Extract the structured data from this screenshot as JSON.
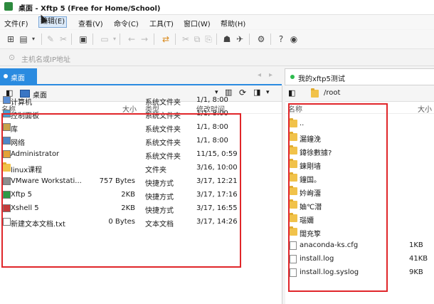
{
  "window": {
    "title": "桌面   - Xftp 5 (Free for Home/School)"
  },
  "menu": [
    {
      "label": "文件(F)"
    },
    {
      "label": "编辑(E)"
    },
    {
      "label": "查看(V)"
    },
    {
      "label": "命令(C)"
    },
    {
      "label": "工具(T)"
    },
    {
      "label": "窗口(W)"
    },
    {
      "label": "帮助(H)"
    }
  ],
  "address": {
    "placeholder": "主机名或IP地址"
  },
  "left_pane": {
    "tab_label": "桌面",
    "path": "桌面",
    "columns": {
      "name": "名称",
      "size": "大小",
      "type": "类型",
      "modified": "修改时间"
    },
    "rows": [
      {
        "name": "计算机",
        "size": "",
        "type": "系统文件夹",
        "modified": "1/1, 8:00",
        "icon": "computer-icon"
      },
      {
        "name": "控制面板",
        "size": "",
        "type": "系统文件夹",
        "modified": "1/1, 8:00",
        "icon": "control-panel-icon"
      },
      {
        "name": "库",
        "size": "",
        "type": "系统文件夹",
        "modified": "1/1, 8:00",
        "icon": "library-icon"
      },
      {
        "name": "网络",
        "size": "",
        "type": "系统文件夹",
        "modified": "1/1, 8:00",
        "icon": "network-icon"
      },
      {
        "name": "Administrator",
        "size": "",
        "type": "系统文件夹",
        "modified": "11/15, 0:59",
        "icon": "user-icon"
      },
      {
        "name": "linux课程",
        "size": "",
        "type": "文件夹",
        "modified": "3/16, 10:00",
        "icon": "folder-icon"
      },
      {
        "name": "VMware Workstati...",
        "size": "757 Bytes",
        "type": "快捷方式",
        "modified": "3/17, 12:21",
        "icon": "vmware-icon"
      },
      {
        "name": "Xftp 5",
        "size": "2KB",
        "type": "快捷方式",
        "modified": "3/17, 17:16",
        "icon": "xftp-icon"
      },
      {
        "name": "Xshell 5",
        "size": "2KB",
        "type": "快捷方式",
        "modified": "3/17, 16:55",
        "icon": "xshell-icon"
      },
      {
        "name": "新建文本文档.txt",
        "size": "0 Bytes",
        "type": "文本文档",
        "modified": "3/17, 14:26",
        "icon": "text-file-icon"
      }
    ]
  },
  "right_pane": {
    "tab_label": "我的xftp5测试",
    "path": "/root",
    "columns": {
      "name": "名称",
      "size": "大小"
    },
    "rows": [
      {
        "name": "..",
        "size": "",
        "icon": "folder-icon"
      },
      {
        "name": "漏鐘浼",
        "size": "",
        "icon": "folder-icon"
      },
      {
        "name": "鍏徐數據?",
        "size": "",
        "icon": "folder-icon"
      },
      {
        "name": "鍊剛墙",
        "size": "",
        "icon": "folder-icon"
      },
      {
        "name": "鐘国。",
        "size": "",
        "icon": "folder-icon"
      },
      {
        "name": "妗峋澑",
        "size": "",
        "icon": "folder-icon"
      },
      {
        "name": "妯℃澘",
        "size": "",
        "icon": "folder-icon"
      },
      {
        "name": "瑙嬭",
        "size": "",
        "icon": "folder-icon"
      },
      {
        "name": "闊充箰",
        "size": "",
        "icon": "folder-icon"
      },
      {
        "name": "anaconda-ks.cfg",
        "size": "1KB",
        "icon": "file-icon"
      },
      {
        "name": "install.log",
        "size": "41KB",
        "icon": "file-icon"
      },
      {
        "name": "install.log.syslog",
        "size": "9KB",
        "icon": "file-icon"
      }
    ]
  },
  "colors": {
    "accent": "#2a8be0",
    "highlight_box": "#e0262a",
    "folder": "#f1c24a",
    "tab_dot": "#2dbb4e"
  }
}
